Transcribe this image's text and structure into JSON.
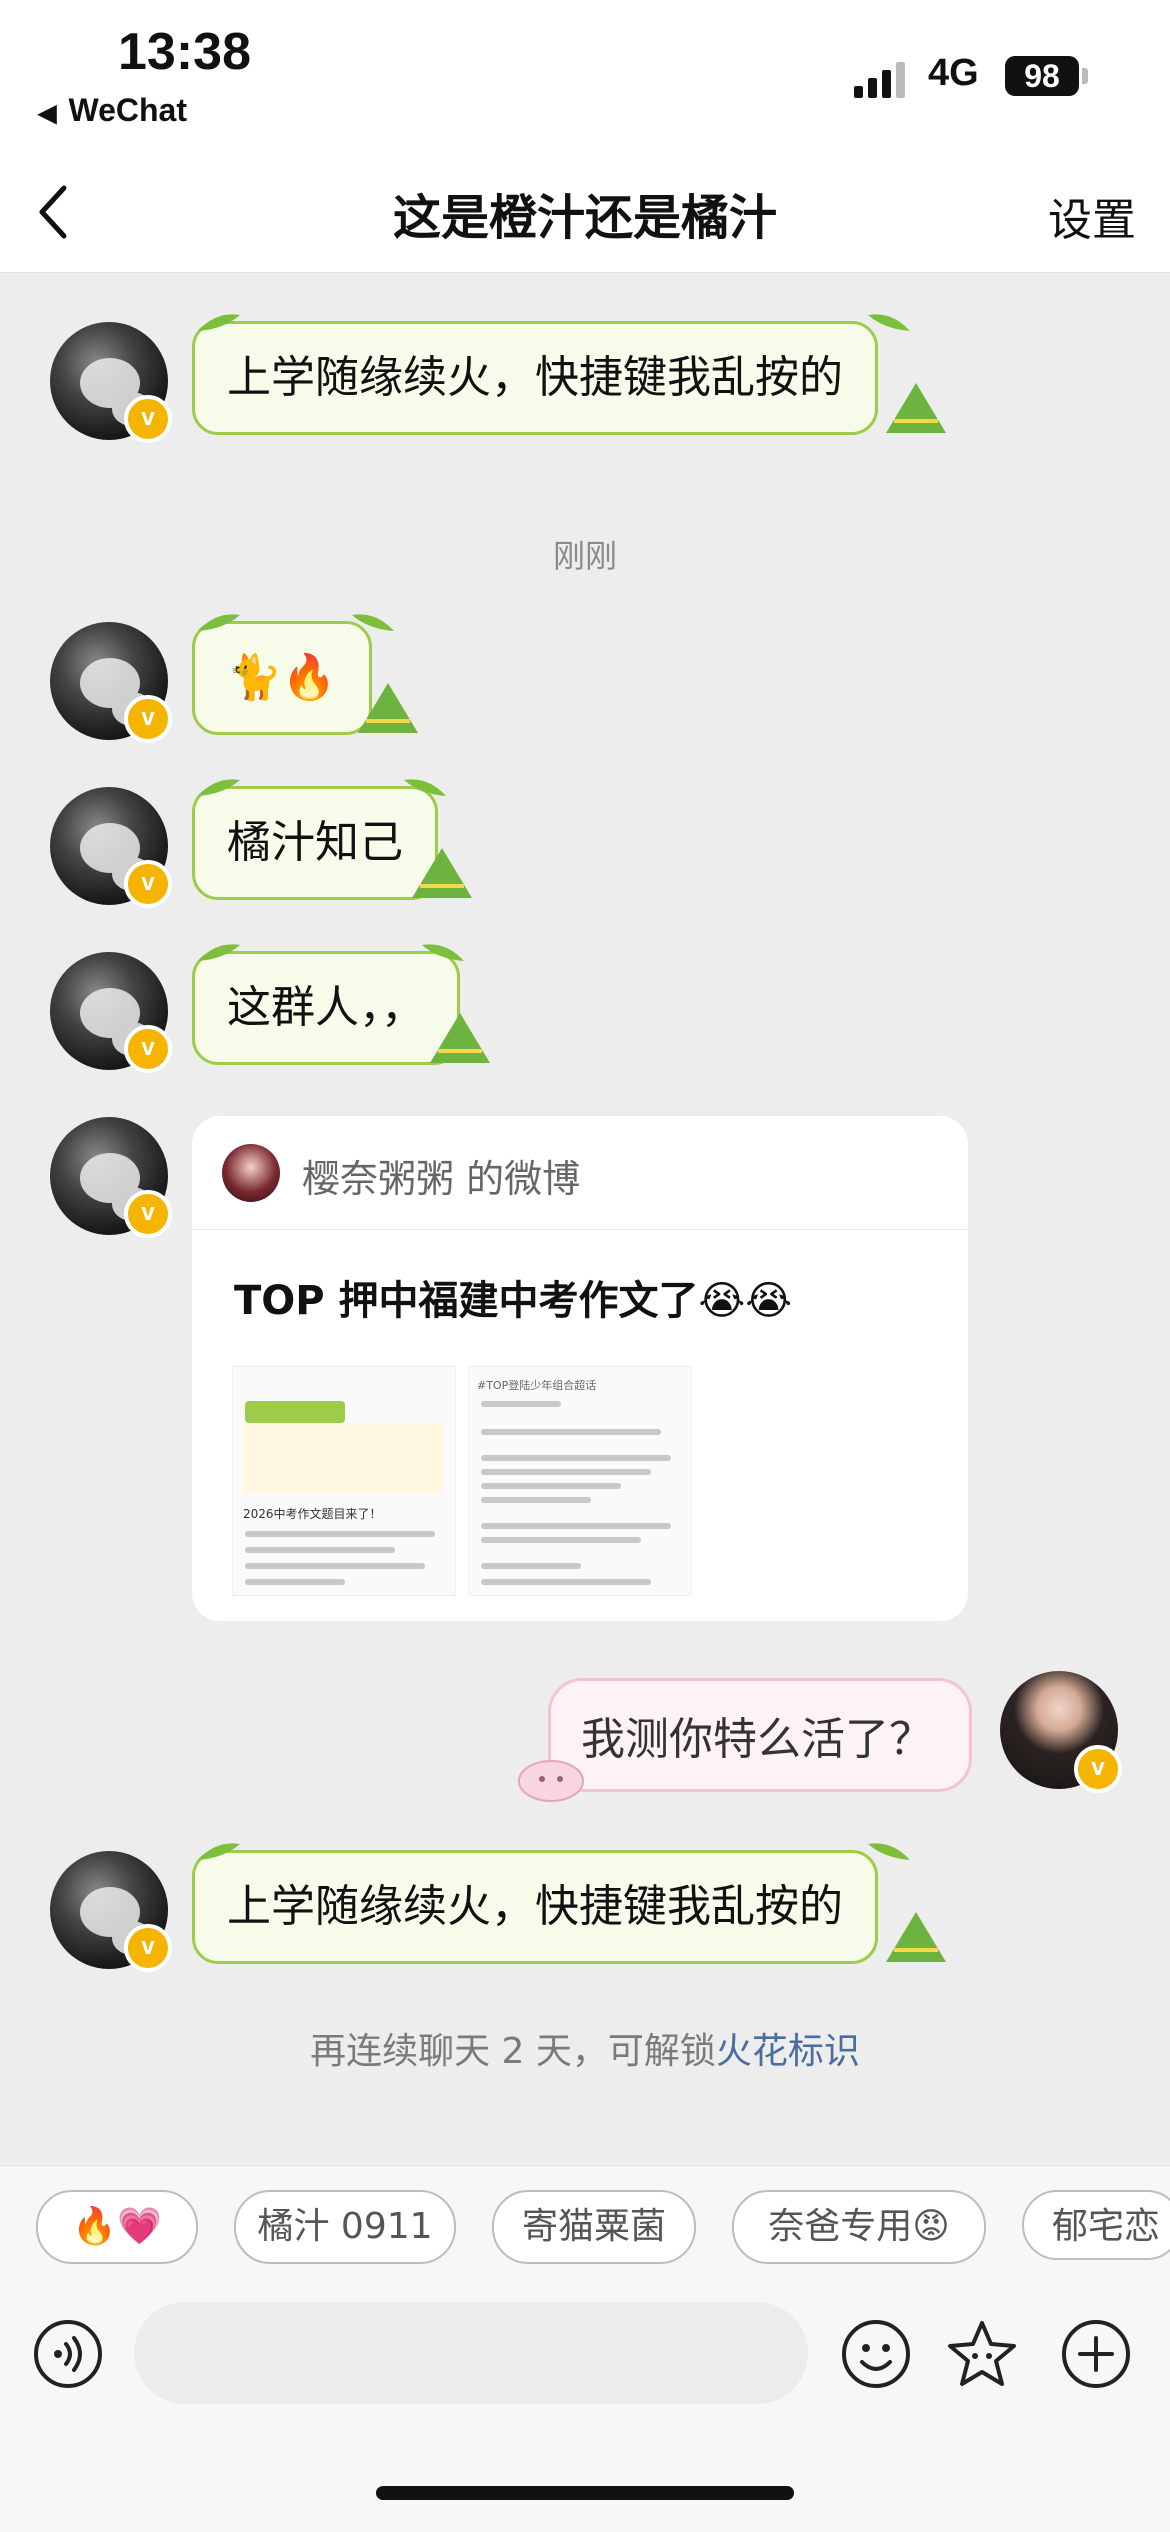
{
  "status_bar": {
    "time": "13:38",
    "back_app": "WeChat",
    "network": "4G",
    "battery": "98"
  },
  "header": {
    "title": "这是橙汁还是橘汁",
    "settings_label": "设置"
  },
  "timestamp": "刚刚",
  "messages": [
    {
      "text": "上学随缘续火，快捷键我乱按的"
    },
    {
      "text": "🐈🔥"
    },
    {
      "text": "橘汁知己"
    },
    {
      "text": "这群人，，"
    },
    {
      "text": "上学随缘续火，快捷键我乱按的"
    }
  ],
  "share_card": {
    "source": "樱奈粥粥 的微博",
    "text": "TOP 押中福建中考作文了😭😭",
    "thumb1_title": "2026中考作文题目来了！",
    "thumb2_title": "#TOP登陆少年组合超话"
  },
  "my_message": {
    "text": "我测你特么活了？"
  },
  "hint": {
    "prefix": "再连续聊天 2 天，可解锁",
    "link": "火花标识"
  },
  "quick_replies": [
    "🔥💗",
    "橘汁 0911",
    "寄猫粟菌",
    "奈爸专用😡",
    "郁宅恋"
  ],
  "icons": {
    "voice": "voice-icon",
    "emoji": "emoji-icon",
    "sticker": "star-sticker-icon",
    "add": "plus-icon"
  }
}
